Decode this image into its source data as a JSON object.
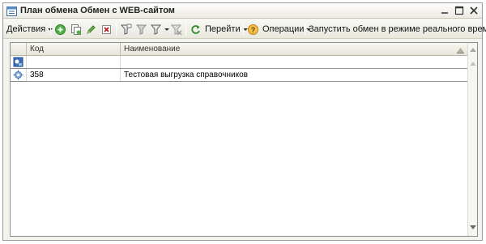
{
  "window": {
    "title": "План обмена Обмен с WEB-сайтом"
  },
  "toolbar": {
    "actions_label": "Действия",
    "goto_label": "Перейти",
    "operations_label": "Операции",
    "realtime_label": "Запустить обмен в режиме реального времени"
  },
  "table": {
    "columns": [
      "Код",
      "Наименование"
    ],
    "rows": [
      {
        "code": "",
        "name": ""
      },
      {
        "code": "358",
        "name": "Тестовая выгрузка справочников"
      }
    ]
  },
  "colors": {
    "accent_green": "#3b9c32",
    "accent_red": "#c02020",
    "help_orange": "#e39a1a"
  }
}
